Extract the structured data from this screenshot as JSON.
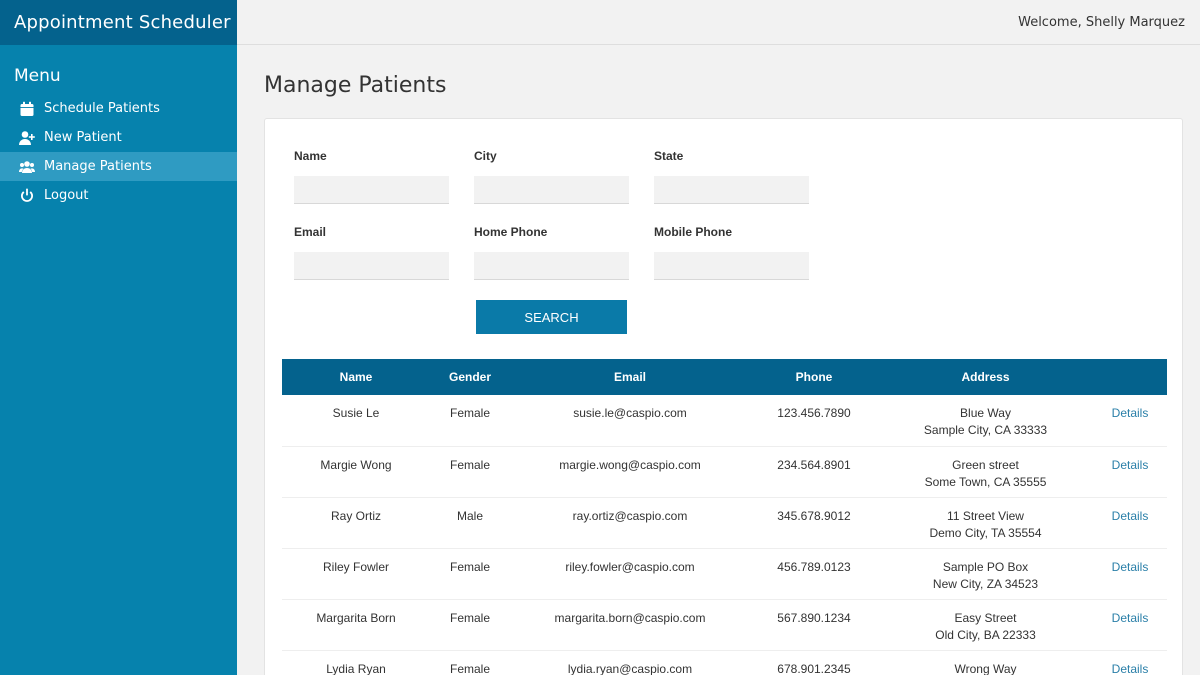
{
  "app": {
    "title": "Appointment Scheduler"
  },
  "header": {
    "welcome": "Welcome, Shelly Marquez"
  },
  "sidebar": {
    "menu_title": "Menu",
    "items": [
      {
        "label": "Schedule Patients",
        "icon": "calendar-icon"
      },
      {
        "label": "New Patient",
        "icon": "user-plus-icon"
      },
      {
        "label": "Manage Patients",
        "icon": "users-icon",
        "active": true
      },
      {
        "label": "Logout",
        "icon": "power-icon"
      }
    ]
  },
  "page": {
    "title": "Manage Patients"
  },
  "search_form": {
    "fields": [
      {
        "label": "Name",
        "value": "",
        "placeholder": ""
      },
      {
        "label": "City",
        "value": "",
        "placeholder": ""
      },
      {
        "label": "State",
        "value": "",
        "placeholder": ""
      },
      {
        "label": "Email",
        "value": "",
        "placeholder": ""
      },
      {
        "label": "Home Phone",
        "value": "",
        "placeholder": ""
      },
      {
        "label": "Mobile Phone",
        "value": "",
        "placeholder": ""
      }
    ],
    "search_label": "Search"
  },
  "table": {
    "columns": [
      "Name",
      "Gender",
      "Email",
      "Phone",
      "Address",
      ""
    ],
    "rows": [
      {
        "name": "Susie Le",
        "gender": "Female",
        "email": "susie.le@caspio.com",
        "phone": "123.456.7890",
        "address1": "Blue Way",
        "address2": "Sample City, CA 33333",
        "details": "Details"
      },
      {
        "name": "Margie Wong",
        "gender": "Female",
        "email": "margie.wong@caspio.com",
        "phone": "234.564.8901",
        "address1": "Green street",
        "address2": "Some Town, CA 35555",
        "details": "Details"
      },
      {
        "name": "Ray Ortiz",
        "gender": "Male",
        "email": "ray.ortiz@caspio.com",
        "phone": "345.678.9012",
        "address1": "11 Street View",
        "address2": "Demo City, TA 35554",
        "details": "Details"
      },
      {
        "name": "Riley Fowler",
        "gender": "Female",
        "email": "riley.fowler@caspio.com",
        "phone": "456.789.0123",
        "address1": "Sample PO Box",
        "address2": "New City, ZA 34523",
        "details": "Details"
      },
      {
        "name": "Margarita Born",
        "gender": "Female",
        "email": "margarita.born@caspio.com",
        "phone": "567.890.1234",
        "address1": "Easy Street",
        "address2": "Old City, BA 22333",
        "details": "Details"
      },
      {
        "name": "Lydia Ryan",
        "gender": "Female",
        "email": "lydia.ryan@caspio.com",
        "phone": "678.901.2345",
        "address1": "Wrong Way",
        "address2": "",
        "details": "Details"
      }
    ]
  }
}
